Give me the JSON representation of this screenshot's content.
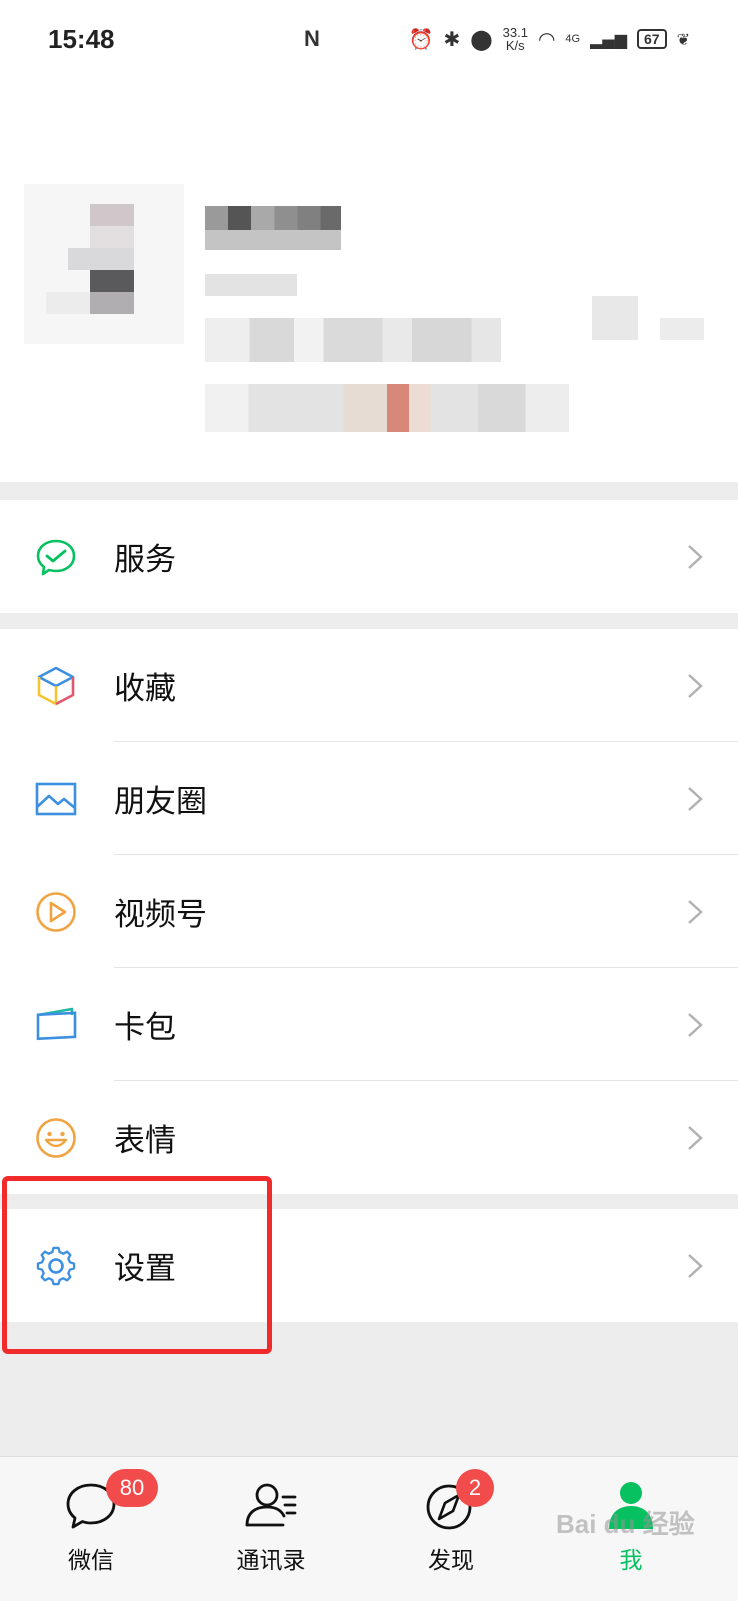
{
  "status_bar": {
    "time": "15:48",
    "nfc": "N",
    "net_speed_value": "33.1",
    "net_speed_unit": "K/s",
    "signal_label": "4G",
    "battery": "67"
  },
  "menu": {
    "service": "服务",
    "favorites": "收藏",
    "moments": "朋友圈",
    "channels": "视频号",
    "cards": "卡包",
    "stickers": "表情",
    "settings": "设置"
  },
  "tabbar": {
    "chats": {
      "label": "微信",
      "badge": "80"
    },
    "contacts": {
      "label": "通讯录"
    },
    "discover": {
      "label": "发现",
      "badge": "2"
    },
    "me": {
      "label": "我"
    }
  },
  "colors": {
    "accent_green": "#07c160",
    "highlight_red": "#f12b2b",
    "badge_red": "#f24b4b"
  },
  "watermark": "Bai du 经验"
}
